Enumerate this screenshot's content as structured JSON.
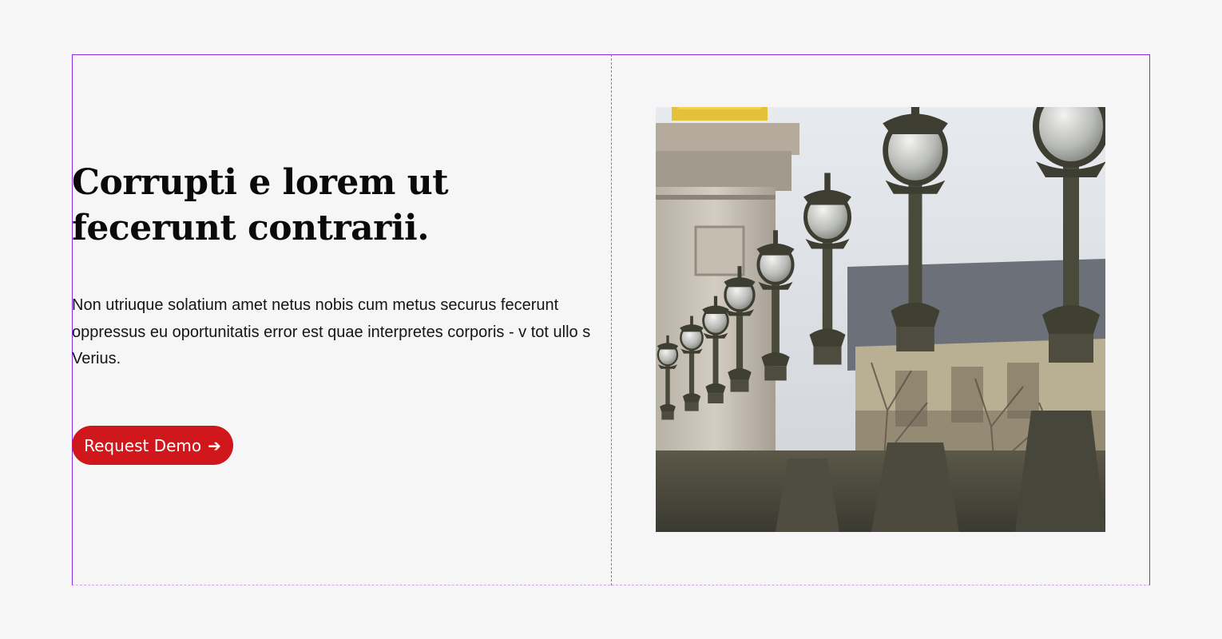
{
  "hero": {
    "headline": "Corrupti e lorem ut fecerunt contrarii.",
    "body": "Non utriuque solatium amet netus nobis cum metus securus fecerunt oppressus eu oportunitatis error est quae interpretes corporis - v tot ullo s Verius.",
    "cta_label": "Request Demo",
    "cta_arrow": "➔"
  },
  "colors": {
    "background": "#f6f6f6",
    "cta_background": "#d0171b",
    "cta_text": "#ffffff",
    "guide_outline": "#8a2be2",
    "headline_text": "#0a0a0a"
  },
  "image": {
    "subject": "row of ornate cast-iron lamp posts on a bridge with a stone pillar topped in gold and a building behind bare trees"
  }
}
